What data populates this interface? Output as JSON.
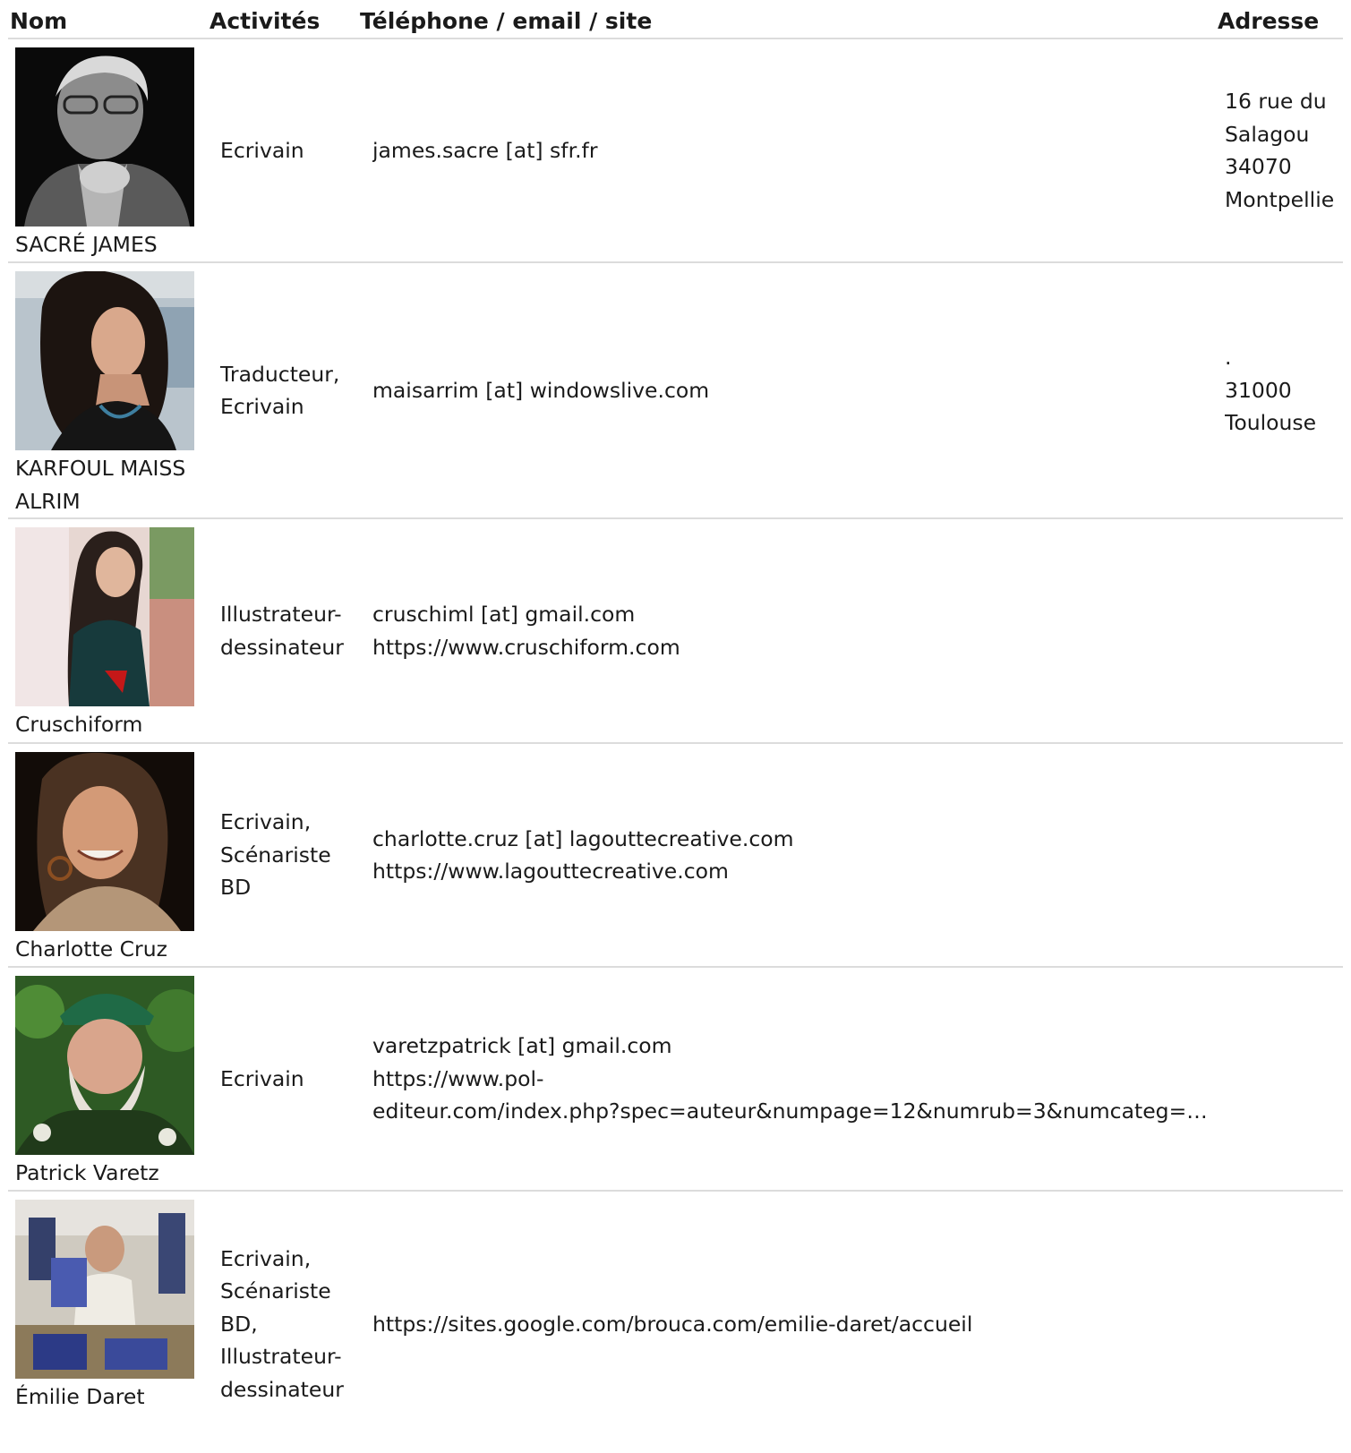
{
  "headers": {
    "nom": "Nom",
    "activites": "Activités",
    "contact": "Téléphone / email / site",
    "adresse": "Adresse"
  },
  "rows": [
    {
      "name": "SACRÉ JAMES",
      "activities": "Ecrivain",
      "contact": [
        "james.sacre [at] sfr.fr"
      ],
      "address": [
        "16 rue du",
        "Salagou",
        "34070",
        "Montpellie"
      ]
    },
    {
      "name": "KARFOUL MAISS ALRIM",
      "activities": "Traducteur, Ecrivain",
      "contact": [
        "maisarrim [at] windowslive.com"
      ],
      "address": [
        ".",
        "31000",
        "Toulouse"
      ]
    },
    {
      "name": "Cruschiform",
      "activities": "Illustrateur-dessinateur",
      "contact": [
        "cruschiml [at] gmail.com",
        "https://www.cruschiform.com"
      ],
      "address": []
    },
    {
      "name": "Charlotte Cruz",
      "activities": "Ecrivain, Scénariste BD",
      "contact": [
        "charlotte.cruz [at] lagouttecreative.com",
        "https://www.lagouttecreative.com"
      ],
      "address": []
    },
    {
      "name": "Patrick Varetz",
      "activities": "Ecrivain",
      "contact": [
        "varetzpatrick [at] gmail.com",
        "https://www.pol-",
        "editeur.com/index.php?spec=auteur&numpage=12&numrub=3&numcateg=…"
      ],
      "address": []
    },
    {
      "name": "Émilie Daret",
      "activities": "Ecrivain, Scénariste BD, Illustrateur-dessinateur",
      "contact": [
        "https://sites.google.com/brouca.com/emilie-daret/accueil"
      ],
      "address": []
    }
  ]
}
